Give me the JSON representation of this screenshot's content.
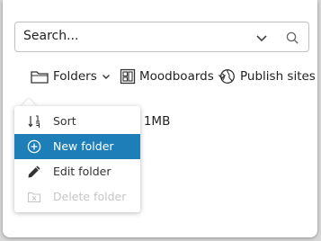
{
  "search": {
    "value": "Search..."
  },
  "toolbar": {
    "folders_label": "Folders",
    "moodboards_label": "Moodboards",
    "publish_label": "Publish sites"
  },
  "background": {
    "partial_text": "n 1MB"
  },
  "folder_menu": {
    "items": [
      {
        "label": "Sort",
        "icon": "sort-icon",
        "state": "normal"
      },
      {
        "label": "New folder",
        "icon": "plus-circle-icon",
        "state": "highlighted"
      },
      {
        "label": "Edit folder",
        "icon": "pencil-icon",
        "state": "normal"
      },
      {
        "label": "Delete folder",
        "icon": "delete-folder-icon",
        "state": "disabled"
      }
    ]
  },
  "colors": {
    "highlight": "#1e7fb8",
    "disabled_text": "#c6c6c6"
  }
}
